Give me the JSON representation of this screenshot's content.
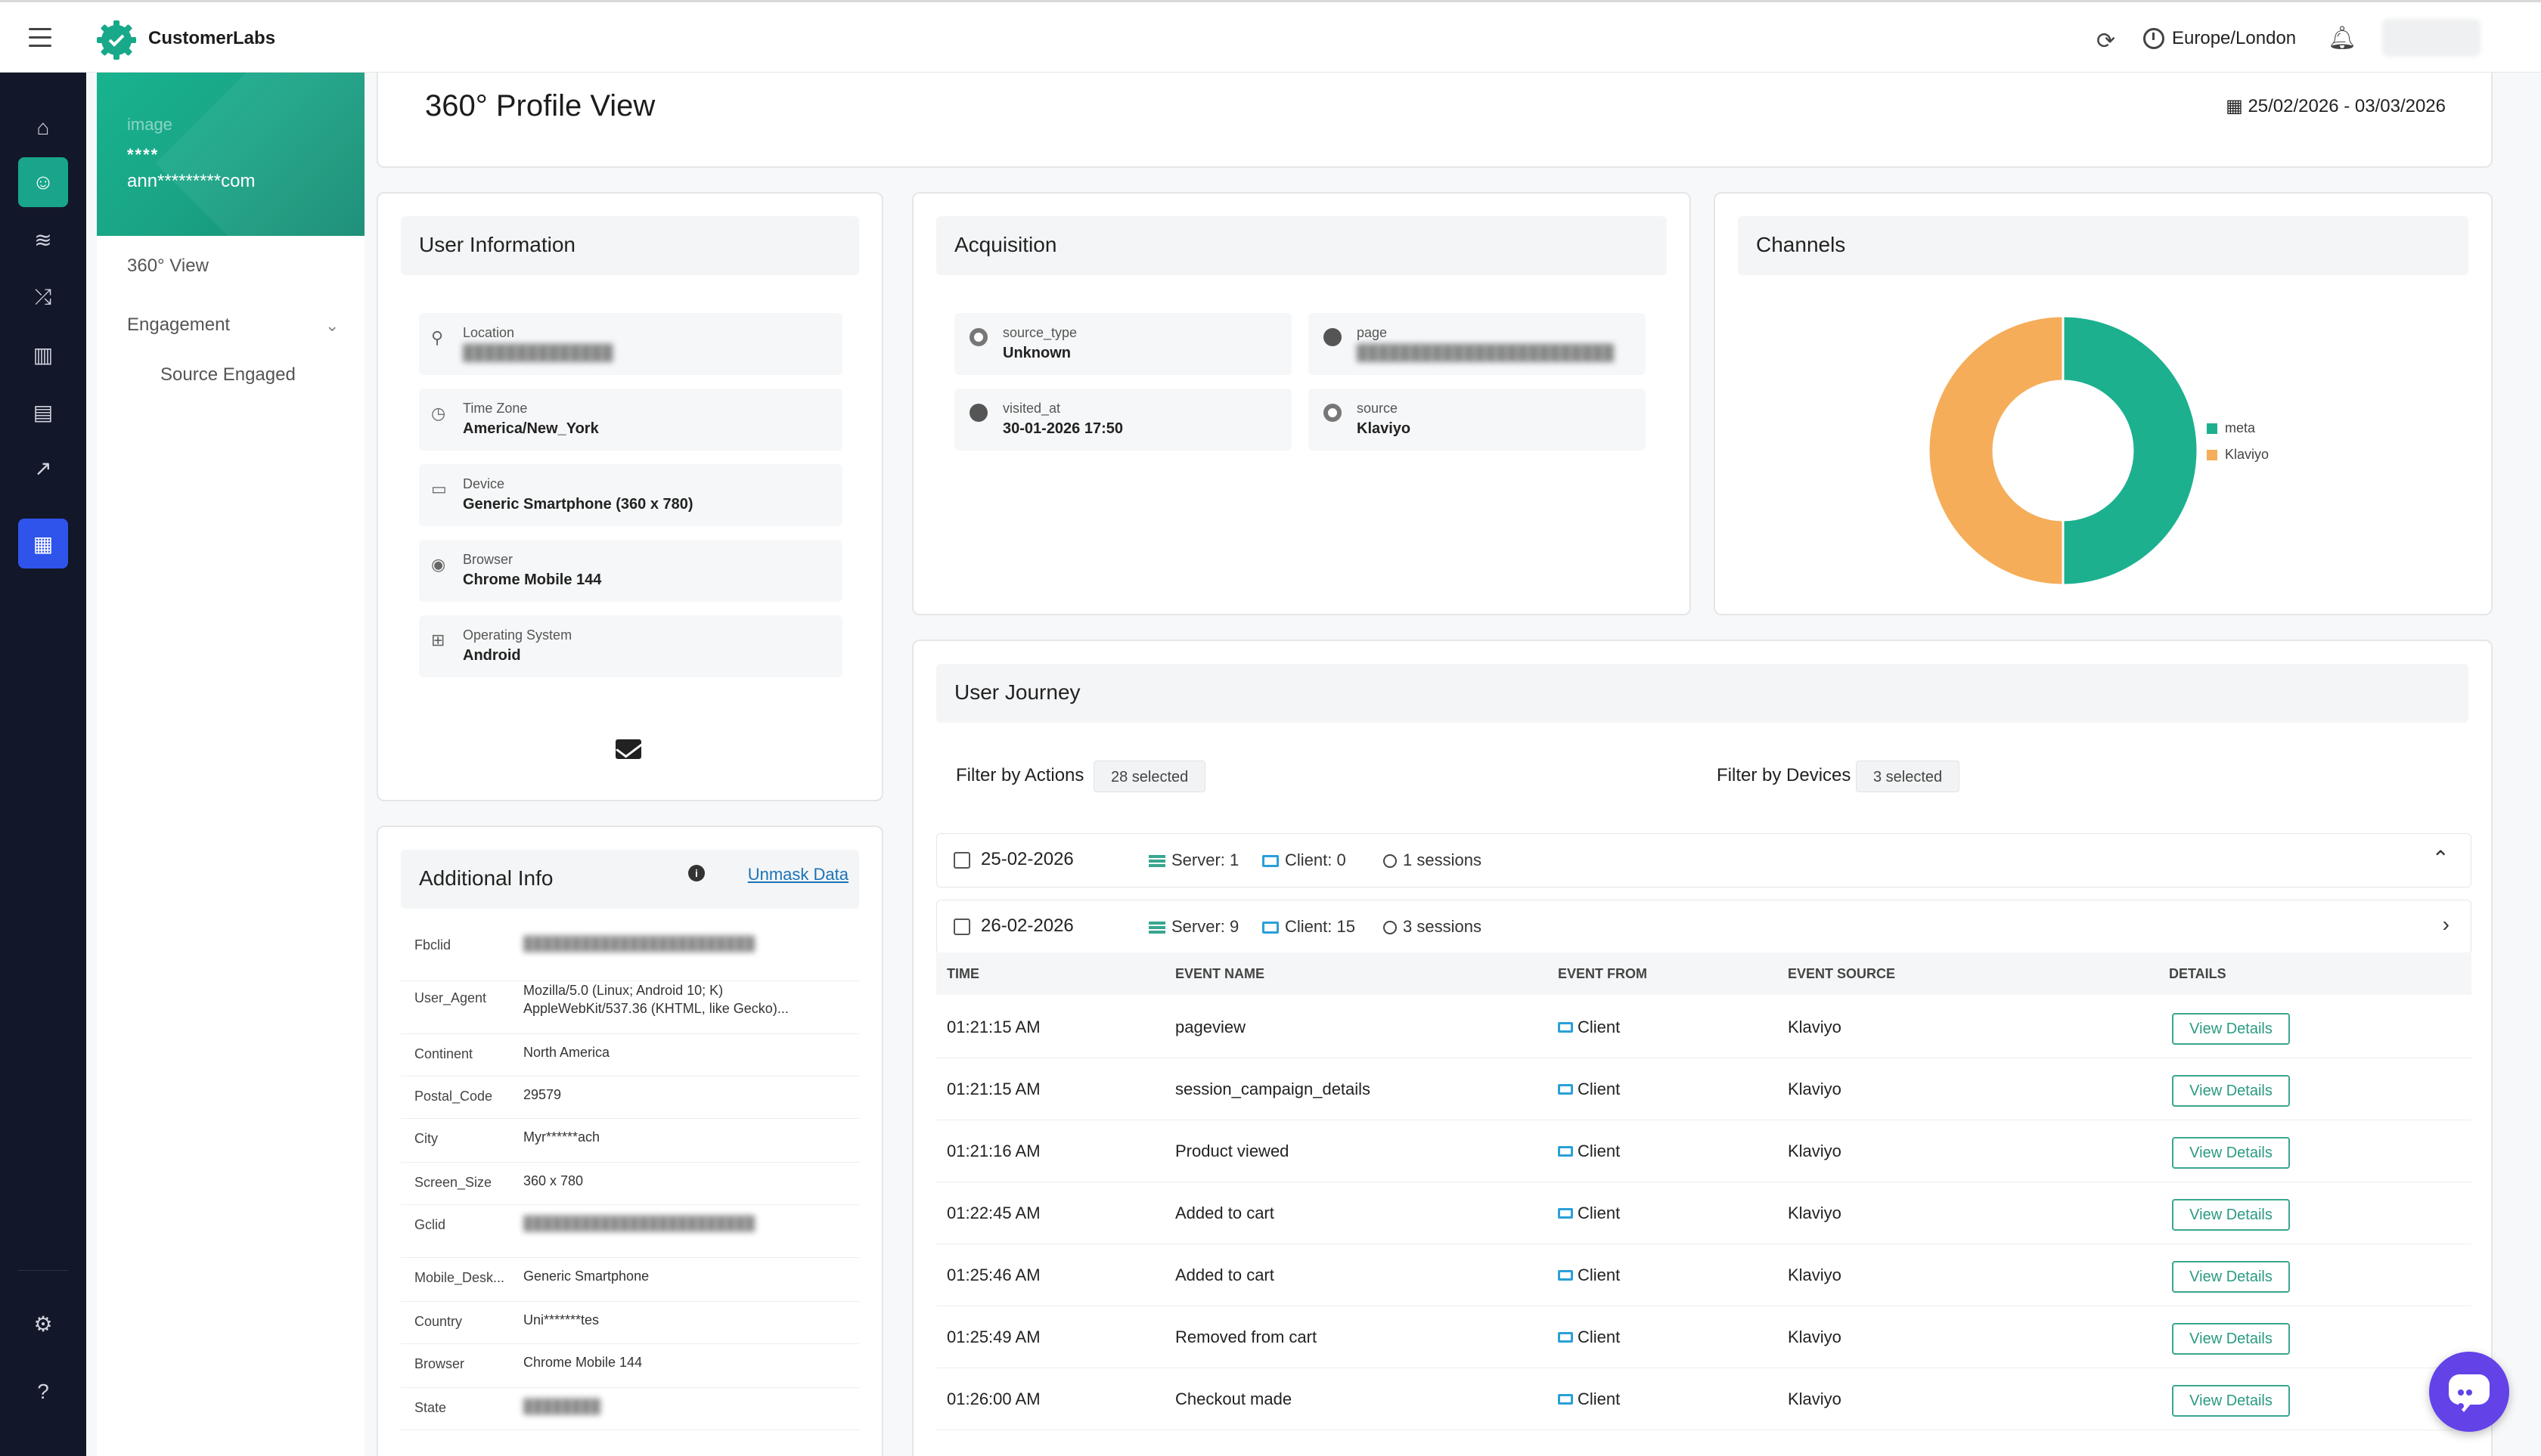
{
  "app": {
    "brand": "CustomerLabs",
    "timezone": "Europe/London"
  },
  "profile": {
    "image_alt": "image",
    "name": "****",
    "email": "ann*********com"
  },
  "subnav": {
    "view": "360° View",
    "engagement": "Engagement",
    "source_engaged": "Source Engaged"
  },
  "page": {
    "title": "360° Profile View",
    "date_range": "25/02/2026 - 03/03/2026"
  },
  "user_info": {
    "title": "User Information",
    "fields": [
      {
        "label": "Location",
        "value": "██████████████"
      },
      {
        "label": "Time Zone",
        "value": "America/New_York"
      },
      {
        "label": "Device",
        "value": "Generic Smartphone (360 x 780)"
      },
      {
        "label": "Browser",
        "value": "Chrome Mobile 144"
      },
      {
        "label": "Operating System",
        "value": "Android"
      }
    ]
  },
  "acquisition": {
    "title": "Acquisition",
    "fields": [
      {
        "label": "source_type",
        "value": "Unknown"
      },
      {
        "label": "page",
        "value": "████████████████████████"
      },
      {
        "label": "visited_at",
        "value": "30-01-2026 17:50"
      },
      {
        "label": "source",
        "value": "Klaviyo"
      }
    ]
  },
  "channels": {
    "title": "Channels",
    "colors": {
      "meta": "#1cb08f",
      "Klaviyo": "#f5ad5a"
    },
    "legend": [
      "meta",
      "Klaviyo"
    ]
  },
  "chart_data": {
    "type": "pie",
    "categories": [
      "meta",
      "Klaviyo"
    ],
    "values": [
      50,
      50
    ],
    "title": "Channels",
    "legend": "right"
  },
  "additional": {
    "title": "Additional Info",
    "unmask": "Unmask Data",
    "rows": [
      {
        "key": "Fbclid",
        "value": "████████████████████████",
        "blur": true
      },
      {
        "key": "User_Agent",
        "value": "Mozilla/5.0 (Linux; Android 10; K) AppleWebKit/537.36 (KHTML, like Gecko)...",
        "blur": false
      },
      {
        "key": "Continent",
        "value": "North America",
        "blur": false
      },
      {
        "key": "Postal_Code",
        "value": "29579",
        "blur": false
      },
      {
        "key": "City",
        "value": "Myr******ach",
        "blur": false
      },
      {
        "key": "Screen_Size",
        "value": "360 x 780",
        "blur": false
      },
      {
        "key": "Gclid",
        "value": "████████████████████████",
        "blur": true
      },
      {
        "key": "Mobile_Desk...",
        "value": "Generic Smartphone",
        "blur": false
      },
      {
        "key": "Country",
        "value": "Uni*******tes",
        "blur": false
      },
      {
        "key": "Browser",
        "value": "Chrome Mobile 144",
        "blur": false
      },
      {
        "key": "State",
        "value": "████████",
        "blur": true
      }
    ]
  },
  "journey": {
    "title": "User Journey",
    "filter_actions_label": "Filter by Actions",
    "filter_actions_value": "28 selected",
    "filter_devices_label": "Filter by Devices",
    "filter_devices_value": "3 selected",
    "days": [
      {
        "date": "25-02-2026",
        "server": "Server: 1",
        "client": "Client: 0",
        "sessions": "1 sessions",
        "arrow": "⌃"
      },
      {
        "date": "26-02-2026",
        "server": "Server: 9",
        "client": "Client: 15",
        "sessions": "3 sessions",
        "arrow": "›"
      }
    ],
    "columns": [
      "TIME",
      "EVENT NAME",
      "EVENT FROM",
      "EVENT SOURCE",
      "DETAILS"
    ],
    "rows": [
      {
        "time": "01:21:15 AM",
        "event": "pageview",
        "from": "Client",
        "source": "Klaviyo",
        "details": "View Details"
      },
      {
        "time": "01:21:15 AM",
        "event": "session_campaign_details",
        "from": "Client",
        "source": "Klaviyo",
        "details": "View Details"
      },
      {
        "time": "01:21:16 AM",
        "event": "Product viewed",
        "from": "Client",
        "source": "Klaviyo",
        "details": "View Details"
      },
      {
        "time": "01:22:45 AM",
        "event": "Added to cart",
        "from": "Client",
        "source": "Klaviyo",
        "details": "View Details"
      },
      {
        "time": "01:25:46 AM",
        "event": "Added to cart",
        "from": "Client",
        "source": "Klaviyo",
        "details": "View Details"
      },
      {
        "time": "01:25:49 AM",
        "event": "Removed from cart",
        "from": "Client",
        "source": "Klaviyo",
        "details": "View Details"
      },
      {
        "time": "01:26:00 AM",
        "event": "Checkout made",
        "from": "Client",
        "source": "Klaviyo",
        "details": "View Details"
      }
    ]
  }
}
